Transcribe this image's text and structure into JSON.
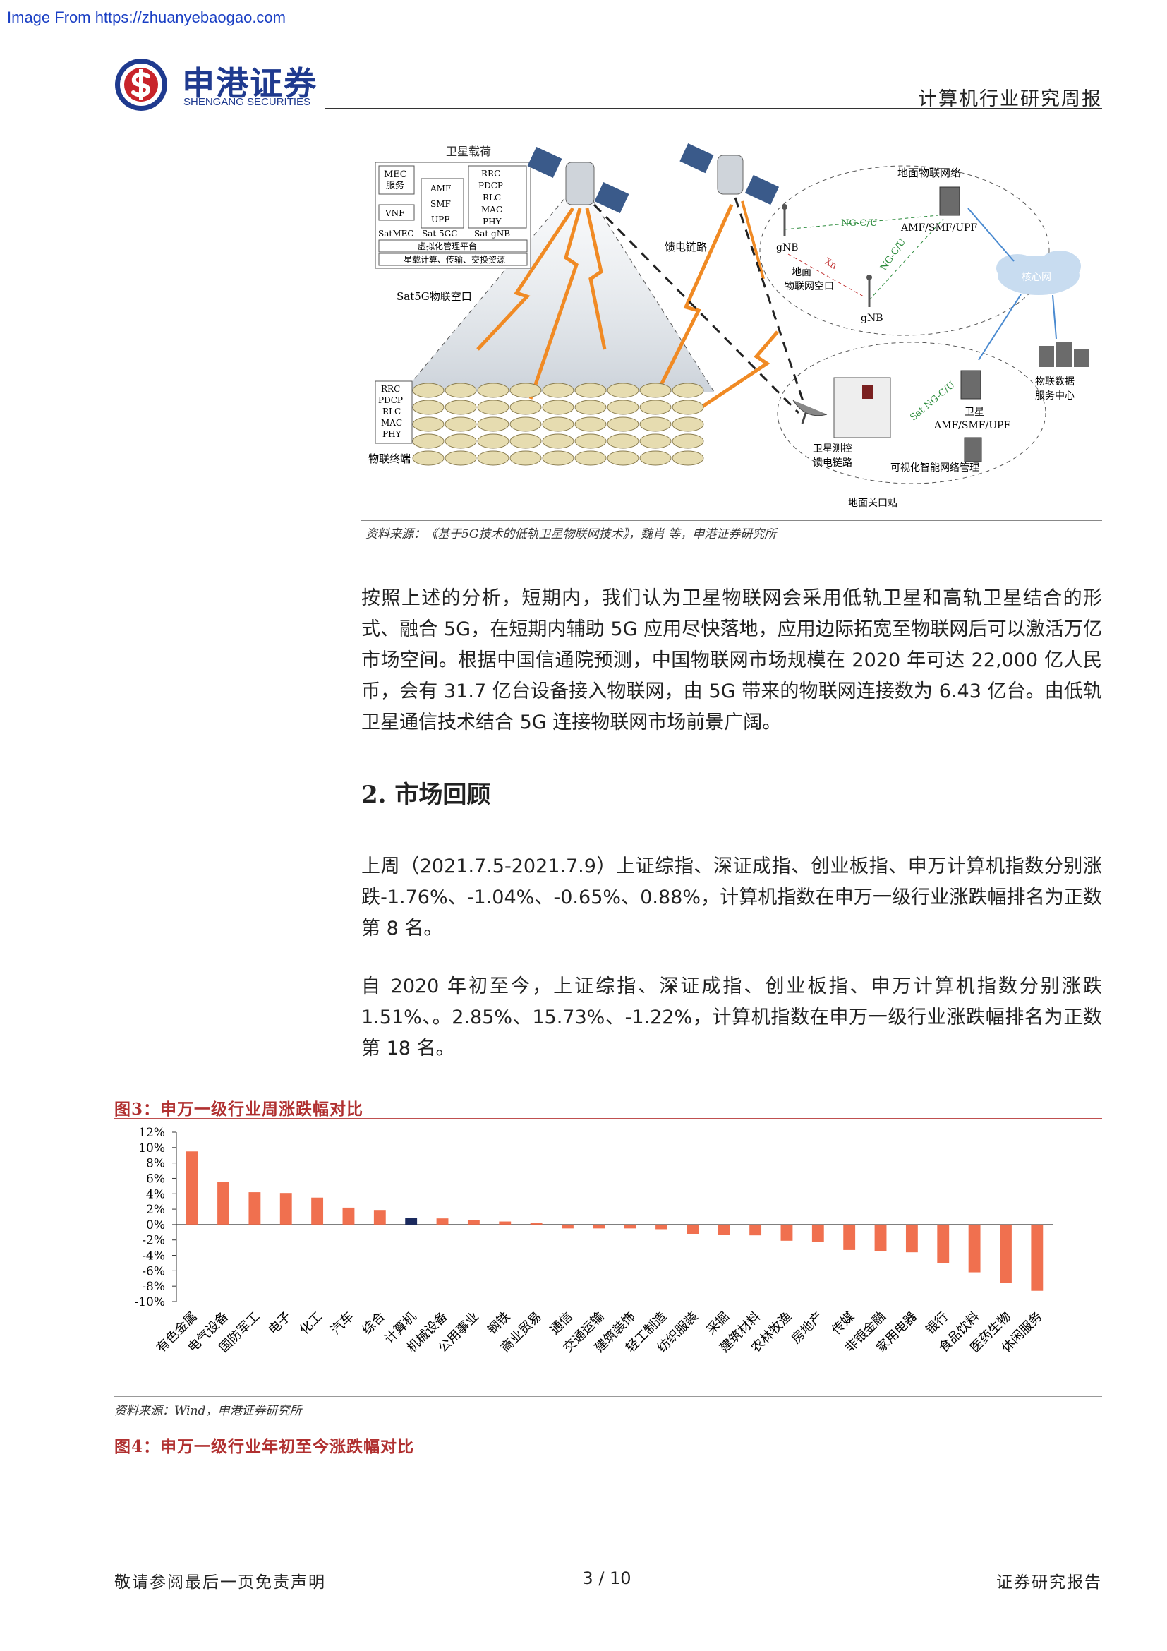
{
  "watermark": "Image From https://zhuanyebaogao.com",
  "header": {
    "company_cn": "申港证券",
    "company_en": "SHENGANG SECURITIES",
    "report_type": "计算机行业研究周报"
  },
  "diagram": {
    "payload_title": "卫星载荷",
    "mec_label": "MEC",
    "mec_service": "服务",
    "vnf": "VNF",
    "satmec": "SatMEC",
    "core_funcs": [
      "AMF",
      "SMF",
      "UPF"
    ],
    "sat_5gc": "Sat 5GC",
    "ran_stack": [
      "RRC",
      "PDCP",
      "RLC",
      "MAC",
      "PHY"
    ],
    "sat_gnb": "Sat gNB",
    "virt_platform": "虚拟化管理平台",
    "onboard": "星载计算、传输、交换资源",
    "air_interface": "Sat5G物联空口",
    "terminal_stack": [
      "RRC",
      "PDCP",
      "RLC",
      "MAC",
      "PHY"
    ],
    "terminal": "物联终端",
    "feeder_link": "馈电链路",
    "ground_iot_net": "地面物联网络",
    "ng_cu_1": "NG-C/U",
    "ng_cu_2": "NG-C/U",
    "amf_smf_upf": "AMF/SMF/UPF",
    "gnb_1": "gNB",
    "gnb_2": "gNB",
    "xn": "Xn",
    "ground_air_1": "地面",
    "ground_air_2": "物联网空口",
    "core_net": "核心网",
    "data_center_1": "物联数据",
    "data_center_2": "服务中心",
    "sat_ng": "Sat NG-C/U",
    "sat_label": "卫星",
    "sat_core": "AMF/SMF/UPF",
    "ttc_1": "卫星测控",
    "ttc_2": "馈电链路",
    "visual_mgmt": "可视化智能网络管理",
    "gateway": "地面关口站"
  },
  "diagram_source": "资料来源：《基于5G技术的低轨卫星物联网技术》，魏肖 等，申港证券研究所",
  "body": {
    "para1": "按照上述的分析，短期内，我们认为卫星物联网会采用低轨卫星和高轨卫星结合的形式、融合 5G，在短期内辅助 5G 应用尽快落地，应用边际拓宽至物联网后可以激活万亿市场空间。根据中国信通院预测，中国物联网市场规模在 2020 年可达 22,000 亿人民币，会有 31.7 亿台设备接入物联网，由 5G 带来的物联网连接数为 6.43 亿台。由低轨卫星通信技术结合 5G 连接物联网市场前景广阔。",
    "section_title": "2. 市场回顾",
    "para2": "上周（2021.7.5-2021.7.9）上证综指、深证成指、创业板指、申万计算机指数分别涨跌-1.76%、-1.04%、-0.65%、0.88%，计算机指数在申万一级行业涨跌幅排名为正数第 8 名。",
    "para3": "自 2020 年初至今，上证综指、深证成指、创业板指、申万计算机指数分别涨跌 1.51%、。2.85%、15.73%、-1.22%，计算机指数在申万一级行业涨跌幅排名为正数第 18 名。"
  },
  "fig3_title": "图3：申万一级行业周涨跌幅对比",
  "chart_source": "资料来源：Wind，申港证券研究所",
  "fig4_title": "图4：申万一级行业年初至今涨跌幅对比",
  "footer": {
    "left": "敬请参阅最后一页免责声明",
    "page": "3 / 10",
    "right": "证券研究报告"
  },
  "chart_data": {
    "type": "bar",
    "categories": [
      "有色金属",
      "电气设备",
      "国防军工",
      "电子",
      "化工",
      "汽车",
      "综合",
      "计算机",
      "机械设备",
      "公用事业",
      "钢铁",
      "商业贸易",
      "通信",
      "交通运输",
      "建筑装饰",
      "轻工制造",
      "纺织服装",
      "采掘",
      "建筑材料",
      "农林牧渔",
      "房地产",
      "传媒",
      "非银金融",
      "家用电器",
      "银行",
      "食品饮料",
      "医药生物",
      "休闲服务"
    ],
    "values": [
      9.5,
      5.5,
      4.2,
      4.1,
      3.5,
      2.2,
      1.9,
      0.88,
      0.8,
      0.6,
      0.4,
      0.2,
      -0.5,
      -0.5,
      -0.5,
      -0.6,
      -1.2,
      -1.3,
      -1.4,
      -2.1,
      -2.3,
      -3.3,
      -3.4,
      -3.6,
      -5.0,
      -6.2,
      -7.6,
      -8.6
    ],
    "highlight_index": 7,
    "ylim": [
      -10,
      12
    ],
    "yticks": [
      "12%",
      "10%",
      "8%",
      "6%",
      "4%",
      "2%",
      "0%",
      "-2%",
      "-4%",
      "-6%",
      "-8%",
      "-10%"
    ],
    "colors": {
      "default": "#f0704f",
      "highlight": "#1b2a5e"
    }
  }
}
